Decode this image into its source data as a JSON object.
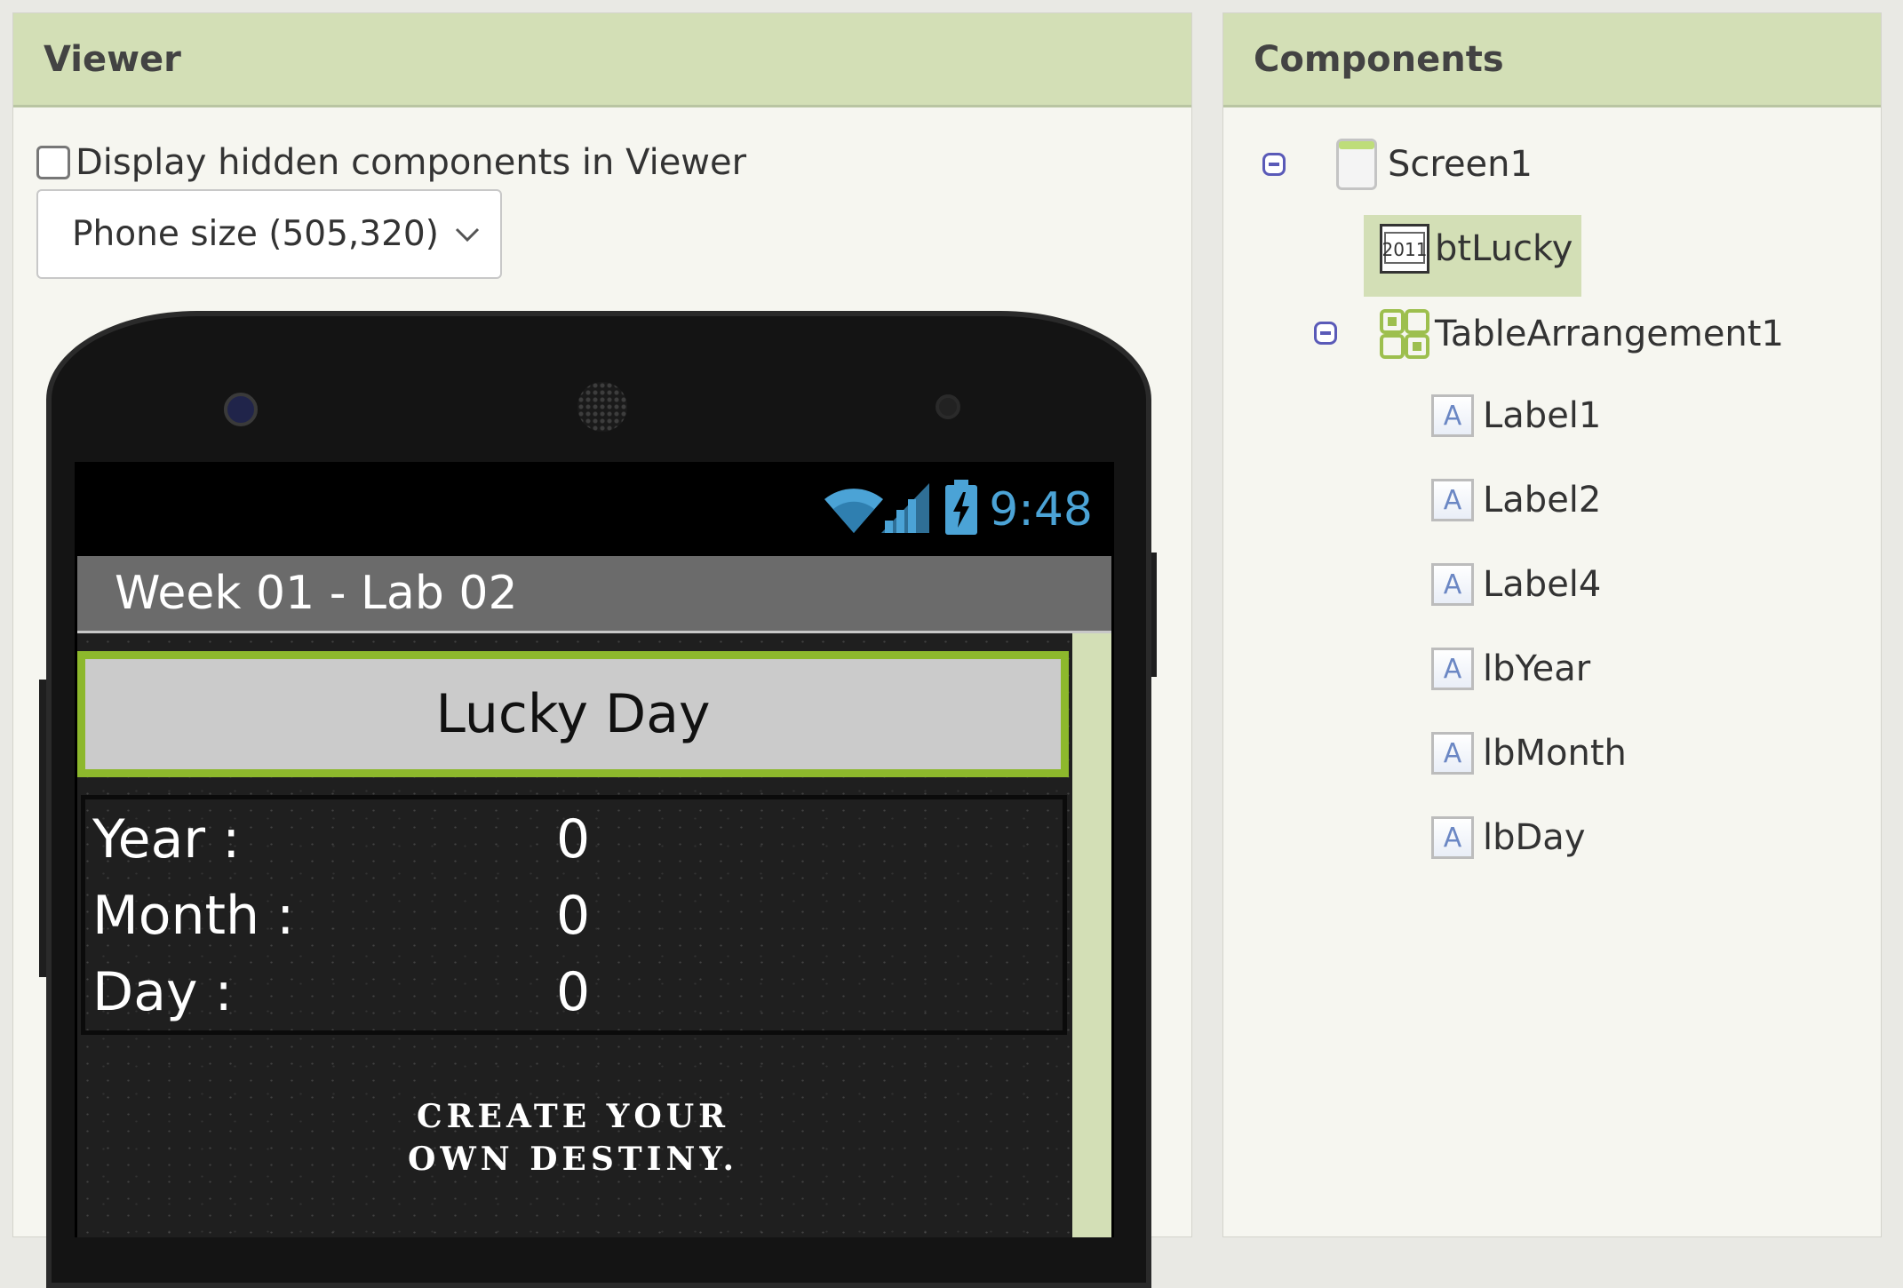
{
  "viewer": {
    "title": "Viewer",
    "hidden_checkbox_label": "Display hidden components in Viewer",
    "hidden_checked": false,
    "size_select_value": "Phone size (505,320)",
    "phone": {
      "status_time": "9:48",
      "app_title": "Week 01  - Lab 02",
      "lucky_button_label": "Lucky Day",
      "rows": [
        {
          "label": "Year :",
          "value": "0"
        },
        {
          "label": "Month :",
          "value": "0"
        },
        {
          "label": "Day :",
          "value": "0"
        }
      ],
      "quote_line1": "CREATE YOUR",
      "quote_line2": "OWN DESTINY."
    }
  },
  "components": {
    "title": "Components",
    "tree": {
      "screen": "Screen1",
      "button": "btLucky",
      "table": "TableArrangement1",
      "labels": [
        "Label1",
        "Label2",
        "Label4",
        "lbYear",
        "lbMonth",
        "lbDay"
      ]
    }
  },
  "colors": {
    "header_bg": "#d3dfb6",
    "button_border": "#8db82c",
    "status_blue": "#4ba3d6",
    "toggle_blue": "#5a5ab8"
  }
}
